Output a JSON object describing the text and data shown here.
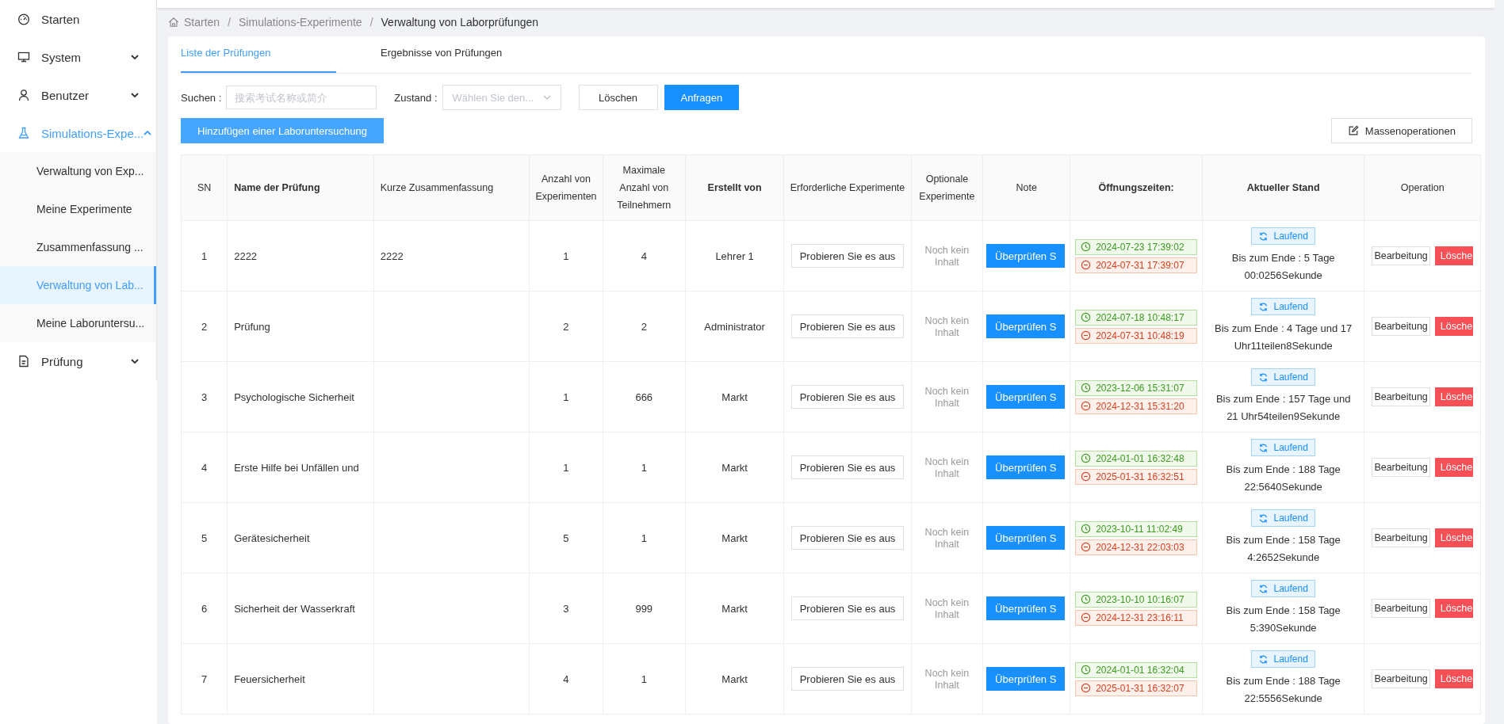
{
  "sidebar": {
    "items": [
      {
        "label": "Starten"
      },
      {
        "label": "System",
        "expanded": false
      },
      {
        "label": "Benutzer",
        "expanded": false
      },
      {
        "label": "Simulations-Expe...",
        "expanded": true,
        "children": [
          {
            "label": "Verwaltung von Exp...",
            "selected": false
          },
          {
            "label": "Meine Experimente",
            "selected": false
          },
          {
            "label": "Zusammenfassung ...",
            "selected": false
          },
          {
            "label": "Verwaltung von Lab...",
            "selected": true
          },
          {
            "label": "Meine Laboruntersu...",
            "selected": false
          }
        ]
      },
      {
        "label": "Prüfung",
        "expanded": false
      }
    ]
  },
  "breadcrumb": {
    "separator": "/",
    "items": [
      "Starten",
      "Simulations-Experimente",
      "Verwaltung von Laborprüfungen"
    ]
  },
  "tabs": [
    {
      "label": "Liste der Prüfungen",
      "selected": true
    },
    {
      "label": "Ergebnisse von Prüfungen",
      "selected": false
    }
  ],
  "filters": {
    "search_label": "Suchen :",
    "search": {
      "placeholder": "搜索考试名称或简介"
    },
    "state_label": "Zustand :",
    "state": {
      "placeholder": "Wählen Sie den..."
    },
    "buttons": [
      "Löschen",
      "Anfragen"
    ]
  },
  "add_button": "Hinzufügen einer Laboruntersuchung",
  "bulk_button": "Massenoperationen",
  "table": {
    "columns": [
      {
        "label": "SN",
        "bold": false
      },
      {
        "label": "Name der Prüfung",
        "bold": true
      },
      {
        "label": "Kurze Zusammenfassung",
        "bold": false
      },
      {
        "label": "Anzahl von Experimenten",
        "bold": false
      },
      {
        "label": "Maximale Anzahl von Teilnehmern",
        "bold": false
      },
      {
        "label": "Erstellt von",
        "bold": true
      },
      {
        "label": "Erforderliche Experimente",
        "bold": false
      },
      {
        "label": "Optionale Experimente",
        "bold": false
      },
      {
        "label": "Note",
        "bold": false
      },
      {
        "label": "Öffnungszeiten:",
        "bold": true
      },
      {
        "label": "Aktueller Stand",
        "bold": true
      },
      {
        "label": "Operation",
        "bold": false
      }
    ],
    "rows": [
      {
        "sn": "1",
        "name": "2222",
        "summary": "2222",
        "experiments": "1",
        "max": "4",
        "creator": "Lehrer 1",
        "required": "Probieren Sie es aus",
        "optional": "Noch kein Inhalt",
        "note": "Überprüfen S",
        "start": "2024-07-23 17:39:02",
        "end": "2024-07-31 17:39:07",
        "status": "Laufend",
        "remaining": "Bis zum Ende : 5 Tage 00:0256Sekunde",
        "edit": "Bearbeitung",
        "delete": "Lösche"
      },
      {
        "sn": "2",
        "name": "Prüfung",
        "summary": "",
        "experiments": "2",
        "max": "2",
        "creator": "Administrator",
        "required": "Probieren Sie es aus",
        "optional": "Noch kein Inhalt",
        "note": "Überprüfen S",
        "start": "2024-07-18 10:48:17",
        "end": "2024-07-31 10:48:19",
        "status": "Laufend",
        "remaining": "Bis zum Ende : 4 Tage und 17 Uhr11teilen8Sekunde",
        "edit": "Bearbeitung",
        "delete": "Lösche"
      },
      {
        "sn": "3",
        "name": "Psychologische Sicherheit",
        "summary": "",
        "experiments": "1",
        "max": "666",
        "creator": "Markt",
        "required": "Probieren Sie es aus",
        "optional": "Noch kein Inhalt",
        "note": "Überprüfen S",
        "start": "2023-12-06 15:31:07",
        "end": "2024-12-31 15:31:20",
        "status": "Laufend",
        "remaining": "Bis zum Ende : 157 Tage und 21 Uhr54teilen9Sekunde",
        "edit": "Bearbeitung",
        "delete": "Lösche"
      },
      {
        "sn": "4",
        "name": "Erste Hilfe bei Unfällen und",
        "summary": "",
        "experiments": "1",
        "max": "1",
        "creator": "Markt",
        "required": "Probieren Sie es aus",
        "optional": "Noch kein Inhalt",
        "note": "Überprüfen S",
        "start": "2024-01-01 16:32:48",
        "end": "2025-01-31 16:32:51",
        "status": "Laufend",
        "remaining": "Bis zum Ende : 188 Tage 22:5640Sekunde",
        "edit": "Bearbeitung",
        "delete": "Lösche"
      },
      {
        "sn": "5",
        "name": "Gerätesicherheit",
        "summary": "",
        "experiments": "5",
        "max": "1",
        "creator": "Markt",
        "required": "Probieren Sie es aus",
        "optional": "Noch kein Inhalt",
        "note": "Überprüfen S",
        "start": "2023-10-11 11:02:49",
        "end": "2024-12-31 22:03:03",
        "status": "Laufend",
        "remaining": "Bis zum Ende : 158 Tage 4:2652Sekunde",
        "edit": "Bearbeitung",
        "delete": "Lösche"
      },
      {
        "sn": "6",
        "name": "Sicherheit der Wasserkraft",
        "summary": "",
        "experiments": "3",
        "max": "999",
        "creator": "Markt",
        "required": "Probieren Sie es aus",
        "optional": "Noch kein Inhalt",
        "note": "Überprüfen S",
        "start": "2023-10-10 10:16:07",
        "end": "2024-12-31 23:16:11",
        "status": "Laufend",
        "remaining": "Bis zum Ende : 158 Tage 5:390Sekunde",
        "edit": "Bearbeitung",
        "delete": "Lösche"
      },
      {
        "sn": "7",
        "name": "Feuersicherheit",
        "summary": "",
        "experiments": "4",
        "max": "1",
        "creator": "Markt",
        "required": "Probieren Sie es aus",
        "optional": "Noch kein Inhalt",
        "note": "Überprüfen S",
        "start": "2024-01-01 16:32:04",
        "end": "2025-01-31 16:32:07",
        "status": "Laufend",
        "remaining": "Bis zum Ende : 188 Tage 22:5556Sekunde",
        "edit": "Bearbeitung",
        "delete": "Lösche"
      }
    ]
  }
}
